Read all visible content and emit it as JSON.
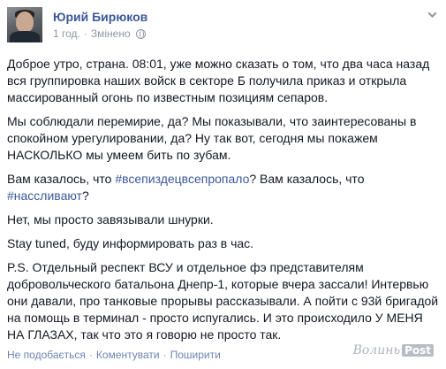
{
  "post": {
    "author": "Юрий Бирюков",
    "time": "1 год.",
    "separator": "·",
    "edited": "Змінено",
    "paragraphs": [
      {
        "parts": [
          {
            "text": "Доброе утро, страна. 08:01, уже можно сказать о том, что два часа назад вся группировка наших войск в секторе Б получила приказ и открыла массированный огонь по известным позициям сепаров."
          }
        ]
      },
      {
        "parts": [
          {
            "text": "Мы соблюдали перемирие, да? Мы показывали, что заинтересованы в спокойном урегулировании, да? Ну так вот, сегодня мы покажем НАСКОЛЬКО мы умеем бить по зубам."
          }
        ]
      },
      {
        "parts": [
          {
            "text": "Вам казалось, что "
          },
          {
            "text": "#всепиздецвсепропало",
            "hashtag": true
          },
          {
            "text": "? Вам казалось, что "
          },
          {
            "text": "#нассливают",
            "hashtag": true
          },
          {
            "text": "?"
          }
        ]
      },
      {
        "parts": [
          {
            "text": "Нет, мы просто завязывали шнурки."
          }
        ]
      },
      {
        "parts": [
          {
            "text": "Stay tuned, буду информировать раз в час."
          }
        ]
      },
      {
        "parts": [
          {
            "text": "P.S. Отдельный респект ВСУ и отдельное фэ представителям добровольческого батальона Днепр-1, которые вчера зассали! Интервью они давали, про танковые прорывы рассказывали. А пойти с 93й бригадой на помощь в терминал - просто испугались. И это происходило У МЕНЯ НА ГЛАЗАХ, так что это я говорю не просто так."
          }
        ]
      }
    ]
  },
  "actions": {
    "like": "Не подобається",
    "comment": "Коментувати",
    "share": "Поширити",
    "separator": "·"
  },
  "watermark": {
    "text": "Волинь",
    "box": "Post"
  },
  "colors": {
    "link": "#3b5998",
    "meta": "#9197a3",
    "text": "#141823"
  },
  "icons": {
    "privacy": "globe-icon",
    "menu": "chevron-down-icon"
  }
}
